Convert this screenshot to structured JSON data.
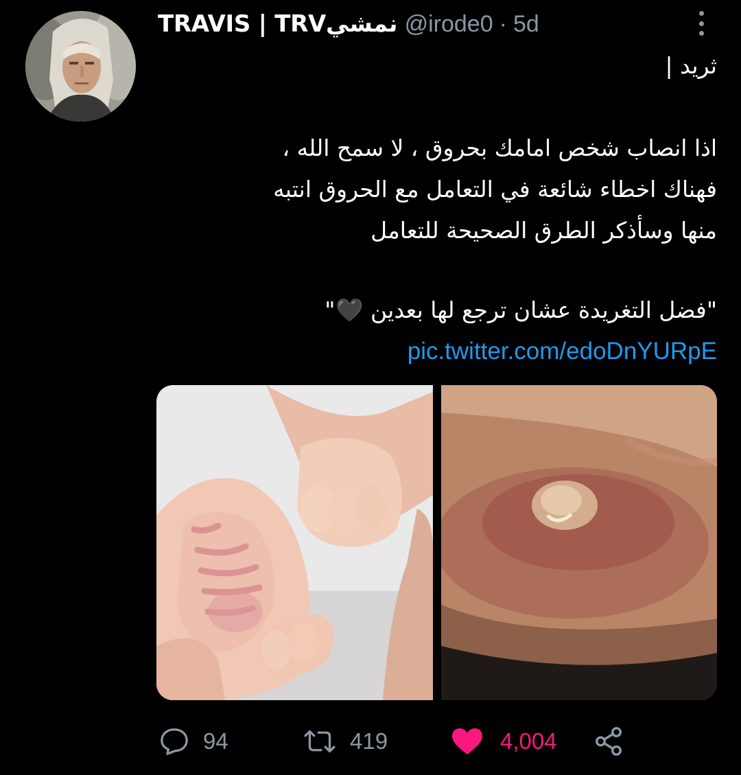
{
  "tweet": {
    "author": {
      "display_name": "TRAVIS | TRVنمشي",
      "handle": "@irode0",
      "separator": "·",
      "time": "5d"
    },
    "text_lines": [
      "ثريد |",
      "اذا انصاب شخص امامك بحروق ، لا سمح الله ،",
      "فهناك اخطاء شائعة في التعامل مع الحروق انتبه",
      "منها وسأذكر الطرق الصحيحة للتعامل",
      "\"فضل التغريدة عشان ترجع لها بعدين 🖤\""
    ],
    "link": "pic.twitter.com/edoDnYURpE",
    "stats": {
      "replies": "94",
      "retweets": "419",
      "likes": "4,004"
    }
  },
  "icons": {
    "more": "more-vertical-icon",
    "reply": "reply-icon",
    "retweet": "retweet-icon",
    "like": "heart-icon",
    "share": "share-icon"
  },
  "colors": {
    "background": "#000000",
    "muted": "#8b98a5",
    "link": "#1d9bf0",
    "like": "#f91880"
  }
}
